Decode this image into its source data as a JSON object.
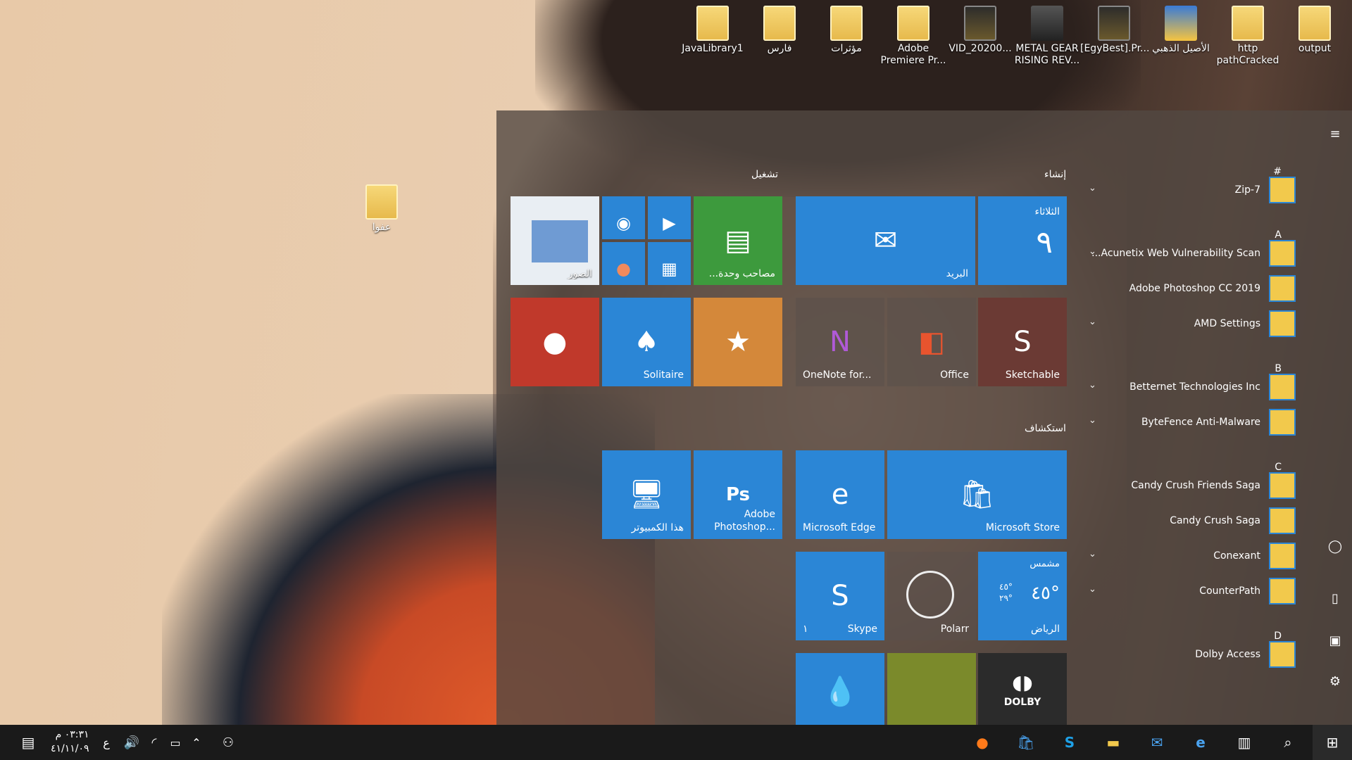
{
  "desktop_icons_top": [
    {
      "label": "JavaLibrary1",
      "type": "folder"
    },
    {
      "label": "فارس",
      "type": "folder"
    },
    {
      "label": "مؤثرات",
      "type": "folder"
    },
    {
      "label": "Adobe Premiere Pr...",
      "type": "folder"
    },
    {
      "label": "VID_20200...",
      "type": "video"
    },
    {
      "label": "METAL GEAR RISING REV...",
      "type": "game"
    },
    {
      "label": "[EgyBest].Pr...",
      "type": "video"
    },
    {
      "label": "الأصيل الذهبي",
      "type": "shield"
    },
    {
      "label": "http pathCracked",
      "type": "folder"
    },
    {
      "label": "output",
      "type": "folder"
    }
  ],
  "desktop_icon_left": {
    "label": "عفوا",
    "type": "folder"
  },
  "start_menu": {
    "group_left_title": "تشغيل",
    "group_right_title": "إنشاء",
    "group_explore_title": "استكشاف",
    "tiles": {
      "photos": "الصور",
      "card_reader": "مصاحب وحدة...",
      "mail": "البريد",
      "calendar_day": "الثلاثاء",
      "calendar_date": "٩",
      "solitaire": "Solitaire",
      "onenote": "OneNote for...",
      "office": "Office",
      "sketchable": "Sketchable",
      "this_pc": "هذا الكمبيوتر",
      "photoshop": "Adobe Photoshop...",
      "edge": "Microsoft Edge",
      "store": "Microsoft Store",
      "skype": "Skype",
      "skype_badge": "١",
      "polarr": "Polarr",
      "weather_cond": "مشمس",
      "weather_temp": "٤٥°",
      "weather_high": "٤٥°",
      "weather_low": "٢٩°",
      "weather_city": "الرياض",
      "dolby": "DOLBY"
    },
    "app_list": [
      {
        "kind": "letter",
        "text": "#"
      },
      {
        "kind": "app",
        "name": "7-Zip",
        "chev": true
      },
      {
        "kind": "letter",
        "text": "A"
      },
      {
        "kind": "app",
        "name": "Acunetix Web Vulnerability Scan...",
        "chev": true
      },
      {
        "kind": "app",
        "name": "Adobe Photoshop CC 2019",
        "chev": false
      },
      {
        "kind": "app",
        "name": "AMD Settings",
        "chev": true
      },
      {
        "kind": "letter",
        "text": "B"
      },
      {
        "kind": "app",
        "name": "Betternet Technologies Inc",
        "chev": true
      },
      {
        "kind": "app",
        "name": "ByteFence Anti-Malware",
        "chev": true
      },
      {
        "kind": "letter",
        "text": "C"
      },
      {
        "kind": "app",
        "name": "Candy Crush Friends Saga",
        "chev": false
      },
      {
        "kind": "app",
        "name": "Candy Crush Saga",
        "chev": false
      },
      {
        "kind": "app",
        "name": "Conexant",
        "chev": true
      },
      {
        "kind": "app",
        "name": "CounterPath",
        "chev": true
      },
      {
        "kind": "letter",
        "text": "D"
      },
      {
        "kind": "app",
        "name": "Dolby Access",
        "chev": false
      }
    ]
  },
  "taskbar": {
    "time": "٠٣:٣١ م",
    "date": "٤١/١١/٠٩",
    "lang": "ع"
  }
}
